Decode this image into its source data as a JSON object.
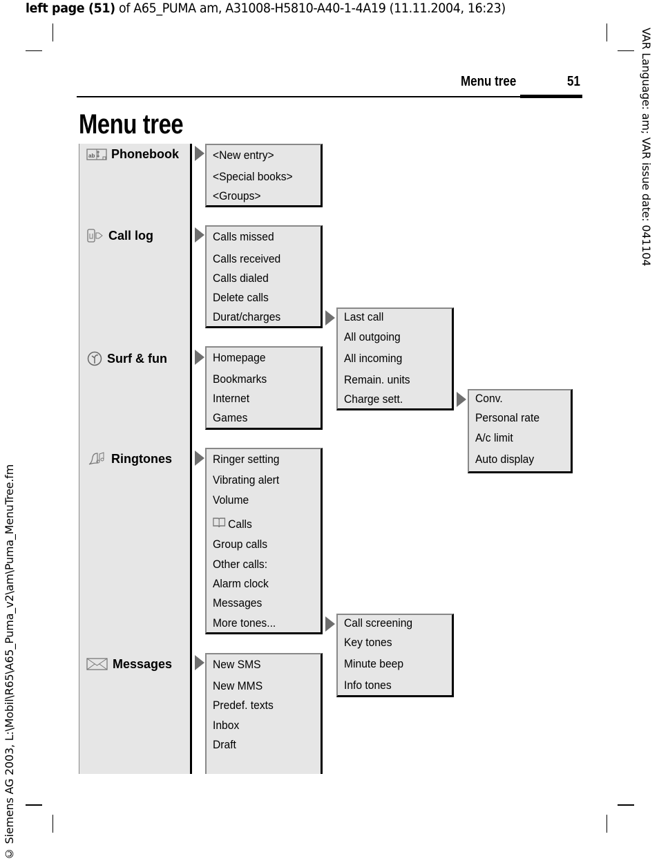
{
  "print_header": {
    "bold": "left page (51)",
    "rest": " of A65_PUMA am, A31008-H5810-A40-1-4A19 (11.11.2004, 16:23)"
  },
  "side_right_text": "VAR Language: am; VAR issue date: 041104",
  "side_left_text": "© Siemens AG 2003, L:\\Mobil\\R65\\A65_Puma_v2\\am\\Puma_MenuTree.fm",
  "running_header": {
    "title": "Menu tree",
    "page": "51"
  },
  "page_title": "Menu tree",
  "main_menu": [
    {
      "label": "Phonebook",
      "icon": "phonebook-icon"
    },
    {
      "label": "Call log",
      "icon": "call-log-icon"
    },
    {
      "label": "Surf & fun",
      "icon": "surf-fun-icon"
    },
    {
      "label": "Ringtones",
      "icon": "ringtones-icon"
    },
    {
      "label": "Messages",
      "icon": "envelope-icon"
    }
  ],
  "submenus": {
    "phonebook": [
      "<New entry>",
      "<Special books>",
      "<Groups>"
    ],
    "call_log": [
      "Calls missed",
      "Calls received",
      "Calls dialed",
      "Delete calls",
      "Durat/charges"
    ],
    "durat_charges": [
      "Last call",
      "All outgoing",
      "All incoming",
      "Remain. units",
      "Charge sett."
    ],
    "charge_sett": [
      "Conv.",
      "Personal rate",
      "A/c limit",
      "Auto display"
    ],
    "surf_fun": [
      "Homepage",
      "Bookmarks",
      "Internet",
      "Games"
    ],
    "ringtones": [
      "Ringer setting",
      "Vibrating alert",
      "Volume",
      "Calls",
      "Group calls",
      "Other calls:",
      "Alarm clock",
      "Messages",
      "More tones..."
    ],
    "more_tones": [
      "Call screening",
      "Key tones",
      "Minute beep",
      "Info tones"
    ],
    "messages": [
      "New SMS",
      "New MMS",
      "Predef. texts",
      "Inbox",
      "Draft"
    ]
  },
  "icons": {
    "ringtones_calls_item": "book-icon",
    "submenu_pointer": "triangle-right-icon"
  }
}
